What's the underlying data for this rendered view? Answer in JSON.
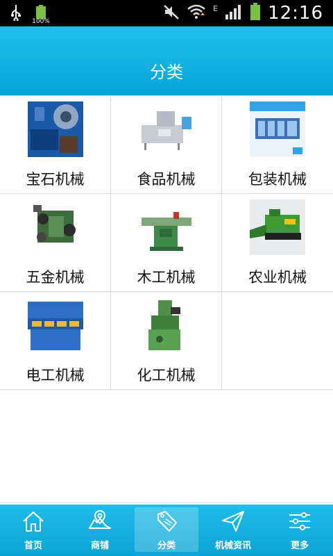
{
  "status_bar": {
    "battery_percent": "100%",
    "time": "12:16",
    "network_type": "E",
    "icons": [
      "usb-icon",
      "battery-icon",
      "mute-icon",
      "wifi-icon",
      "signal-icon",
      "battery-full-icon"
    ]
  },
  "header": {
    "title": "分类"
  },
  "categories": [
    {
      "label": "宝石机械",
      "thumb": "gem-machine-thumb"
    },
    {
      "label": "食品机械",
      "thumb": "food-machine-thumb"
    },
    {
      "label": "包装机械",
      "thumb": "packaging-machine-thumb"
    },
    {
      "label": "五金机械",
      "thumb": "hardware-machine-thumb"
    },
    {
      "label": "木工机械",
      "thumb": "woodworking-machine-thumb"
    },
    {
      "label": "农业机械",
      "thumb": "agriculture-machine-thumb"
    },
    {
      "label": "电工机械",
      "thumb": "electrical-machine-thumb"
    },
    {
      "label": "化工机械",
      "thumb": "chemical-machine-thumb"
    }
  ],
  "tabbar": {
    "items": [
      {
        "label": "首页",
        "icon": "home-icon"
      },
      {
        "label": "商铺",
        "icon": "map-icon"
      },
      {
        "label": "分类",
        "icon": "sale-tag-icon",
        "active": true
      },
      {
        "label": "机械资讯",
        "icon": "send-icon"
      },
      {
        "label": "更多",
        "icon": "sliders-icon"
      }
    ]
  },
  "colors": {
    "header_top": "#21c0ec",
    "header_bottom": "#05a4d8",
    "divider": "#d6d6d6",
    "battery_green": "#7bc043"
  }
}
